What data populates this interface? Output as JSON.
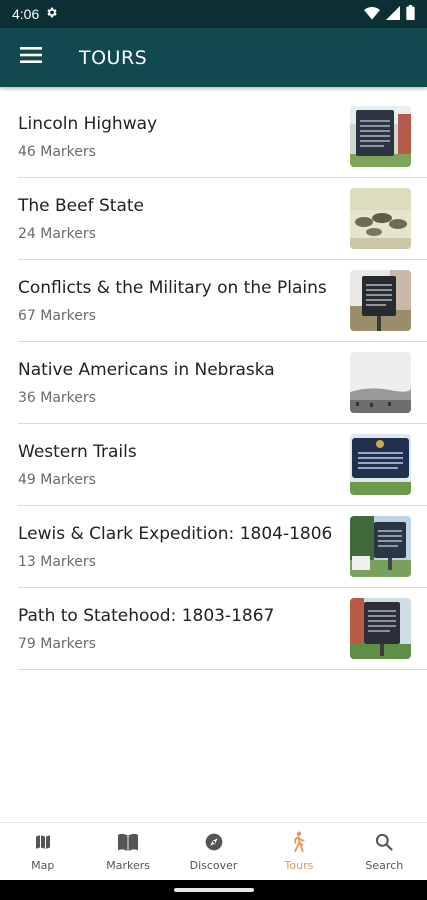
{
  "status_bar": {
    "time": "4:06"
  },
  "app_bar": {
    "title": "TOURS"
  },
  "tours": [
    {
      "title": "Lincoln Highway",
      "count": "46 Markers",
      "thumb": "marker-sign"
    },
    {
      "title": "The Beef State",
      "count": "24 Markers",
      "thumb": "cattle-sketch"
    },
    {
      "title": "Conflicts & the Military on the Plains",
      "count": "67 Markers",
      "thumb": "marker-sign"
    },
    {
      "title": "Native Americans in Nebraska",
      "count": "36 Markers",
      "thumb": "landscape-photo"
    },
    {
      "title": "Western Trails",
      "count": "49 Markers",
      "thumb": "marker-sign"
    },
    {
      "title": "Lewis & Clark Expedition: 1804-1806",
      "count": "13 Markers",
      "thumb": "marker-sign"
    },
    {
      "title": "Path to Statehood: 1803-1867",
      "count": "79 Markers",
      "thumb": "marker-sign"
    }
  ],
  "bottom_nav": [
    {
      "label": "Map",
      "icon": "map-icon"
    },
    {
      "label": "Markers",
      "icon": "book-icon"
    },
    {
      "label": "Discover",
      "icon": "compass-icon"
    },
    {
      "label": "Tours",
      "icon": "walking-icon",
      "active": true
    },
    {
      "label": "Search",
      "icon": "search-icon"
    }
  ],
  "colors": {
    "status_bar": "#0c2f33",
    "app_bar": "#11494f",
    "active_nav": "#e39a55"
  }
}
